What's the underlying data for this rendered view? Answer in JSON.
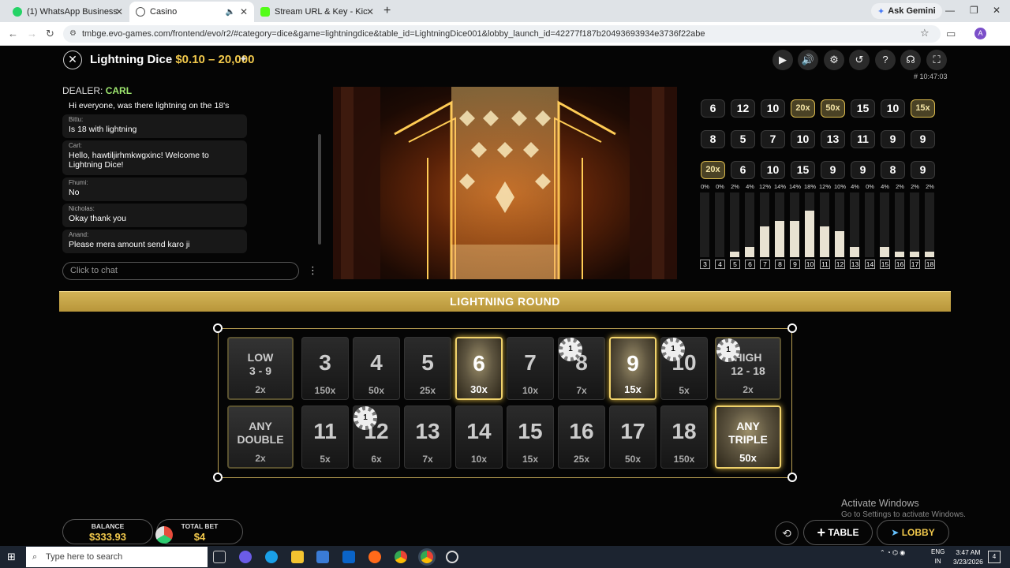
{
  "browser": {
    "tabs": [
      {
        "title": "(1) WhatsApp Business",
        "color": "#25d366"
      },
      {
        "title": "Casino",
        "color": "#555555"
      },
      {
        "title": "Stream URL & Key - Kick Dashb",
        "color": "#53fc18"
      }
    ],
    "gemini_label": "Ask Gemini",
    "url": "tmbge.evo-games.com/frontend/evo/r2/#category=dice&game=lightningdice&table_id=LightningDice001&lobby_launch_id=42277f187b20493693934e3736f22abe",
    "profile_initial": "A"
  },
  "game": {
    "name": "Lightning Dice",
    "limits": "$0.10 – 20,000",
    "round_id": "# 10:47:03",
    "dealer_label": "DEALER:",
    "dealer_name": "CARL"
  },
  "chat": {
    "messages": [
      {
        "user": "",
        "text": "Hi everyone, was there lightning on the 18's"
      },
      {
        "user": "Bittu:",
        "text": "Is 18 with lightning"
      },
      {
        "user": "Carl:",
        "text": "Hello, hawtiljirhmkwgxinc! Welcome to Lightning Dice!"
      },
      {
        "user": "Fhumi:",
        "text": "No"
      },
      {
        "user": "Nicholas:",
        "text": "Okay thank you"
      },
      {
        "user": "Anand:",
        "text": "Please mera amount send karo ji"
      }
    ],
    "placeholder": "Click to chat"
  },
  "history": [
    [
      "6",
      "12",
      "10",
      "20x",
      "50x",
      "15",
      "10",
      "15x"
    ],
    [
      "8",
      "5",
      "7",
      "10",
      "13",
      "11",
      "9",
      "9"
    ],
    [
      "20x",
      "6",
      "10",
      "15",
      "9",
      "9",
      "8",
      "9"
    ]
  ],
  "stats": {
    "numbers": [
      "3",
      "4",
      "5",
      "6",
      "7",
      "8",
      "9",
      "10",
      "11",
      "12",
      "13",
      "14",
      "15",
      "16",
      "17",
      "18"
    ],
    "percents": [
      0,
      0,
      2,
      4,
      12,
      14,
      14,
      18,
      12,
      10,
      4,
      0,
      4,
      2,
      2,
      2
    ],
    "percent_labels": [
      "0%",
      "0%",
      "2%",
      "4%",
      "12%",
      "14%",
      "14%",
      "18%",
      "12%",
      "10%",
      "4%",
      "0%",
      "4%",
      "2%",
      "2%",
      "2%"
    ]
  },
  "banner": "LIGHTNING ROUND",
  "board": {
    "low": {
      "label1": "LOW",
      "label2": "3 - 9",
      "pay": "2x"
    },
    "high": {
      "label1": "HIGH",
      "label2": "12 - 18",
      "pay": "2x"
    },
    "any_double": {
      "label1": "ANY",
      "label2": "DOUBLE",
      "pay": "2x"
    },
    "any_triple": {
      "label1": "ANY",
      "label2": "TRIPLE",
      "pay": "50x"
    },
    "row1": [
      {
        "num": "3",
        "pay": "150x",
        "lit": false
      },
      {
        "num": "4",
        "pay": "50x",
        "lit": false
      },
      {
        "num": "5",
        "pay": "25x",
        "lit": false
      },
      {
        "num": "6",
        "pay": "30x",
        "lit": true
      },
      {
        "num": "7",
        "pay": "10x",
        "lit": false
      },
      {
        "num": "8",
        "pay": "7x",
        "lit": false,
        "chip": "1"
      },
      {
        "num": "9",
        "pay": "15x",
        "lit": true
      },
      {
        "num": "10",
        "pay": "5x",
        "lit": false,
        "chip": "1"
      }
    ],
    "row2": [
      {
        "num": "11",
        "pay": "5x",
        "lit": false
      },
      {
        "num": "12",
        "pay": "6x",
        "lit": false,
        "chip": "1"
      },
      {
        "num": "13",
        "pay": "7x",
        "lit": false
      },
      {
        "num": "14",
        "pay": "10x",
        "lit": false
      },
      {
        "num": "15",
        "pay": "15x",
        "lit": false
      },
      {
        "num": "16",
        "pay": "25x",
        "lit": false
      },
      {
        "num": "17",
        "pay": "50x",
        "lit": false
      },
      {
        "num": "18",
        "pay": "150x",
        "lit": false
      }
    ],
    "high_chip": "1"
  },
  "footer": {
    "balance_label": "BALANCE",
    "balance": "$333.93",
    "total_bet_label": "TOTAL BET",
    "total_bet": "$4",
    "table_label": "TABLE",
    "lobby_label": "LOBBY"
  },
  "watermark": {
    "line1": "Activate Windows",
    "line2": "Go to Settings to activate Windows."
  },
  "taskbar": {
    "search_placeholder": "Type here to search",
    "lang1": "ENG",
    "lang2": "IN",
    "time": "3:47 AM",
    "date": "3/23/2026",
    "notifications": "4"
  }
}
